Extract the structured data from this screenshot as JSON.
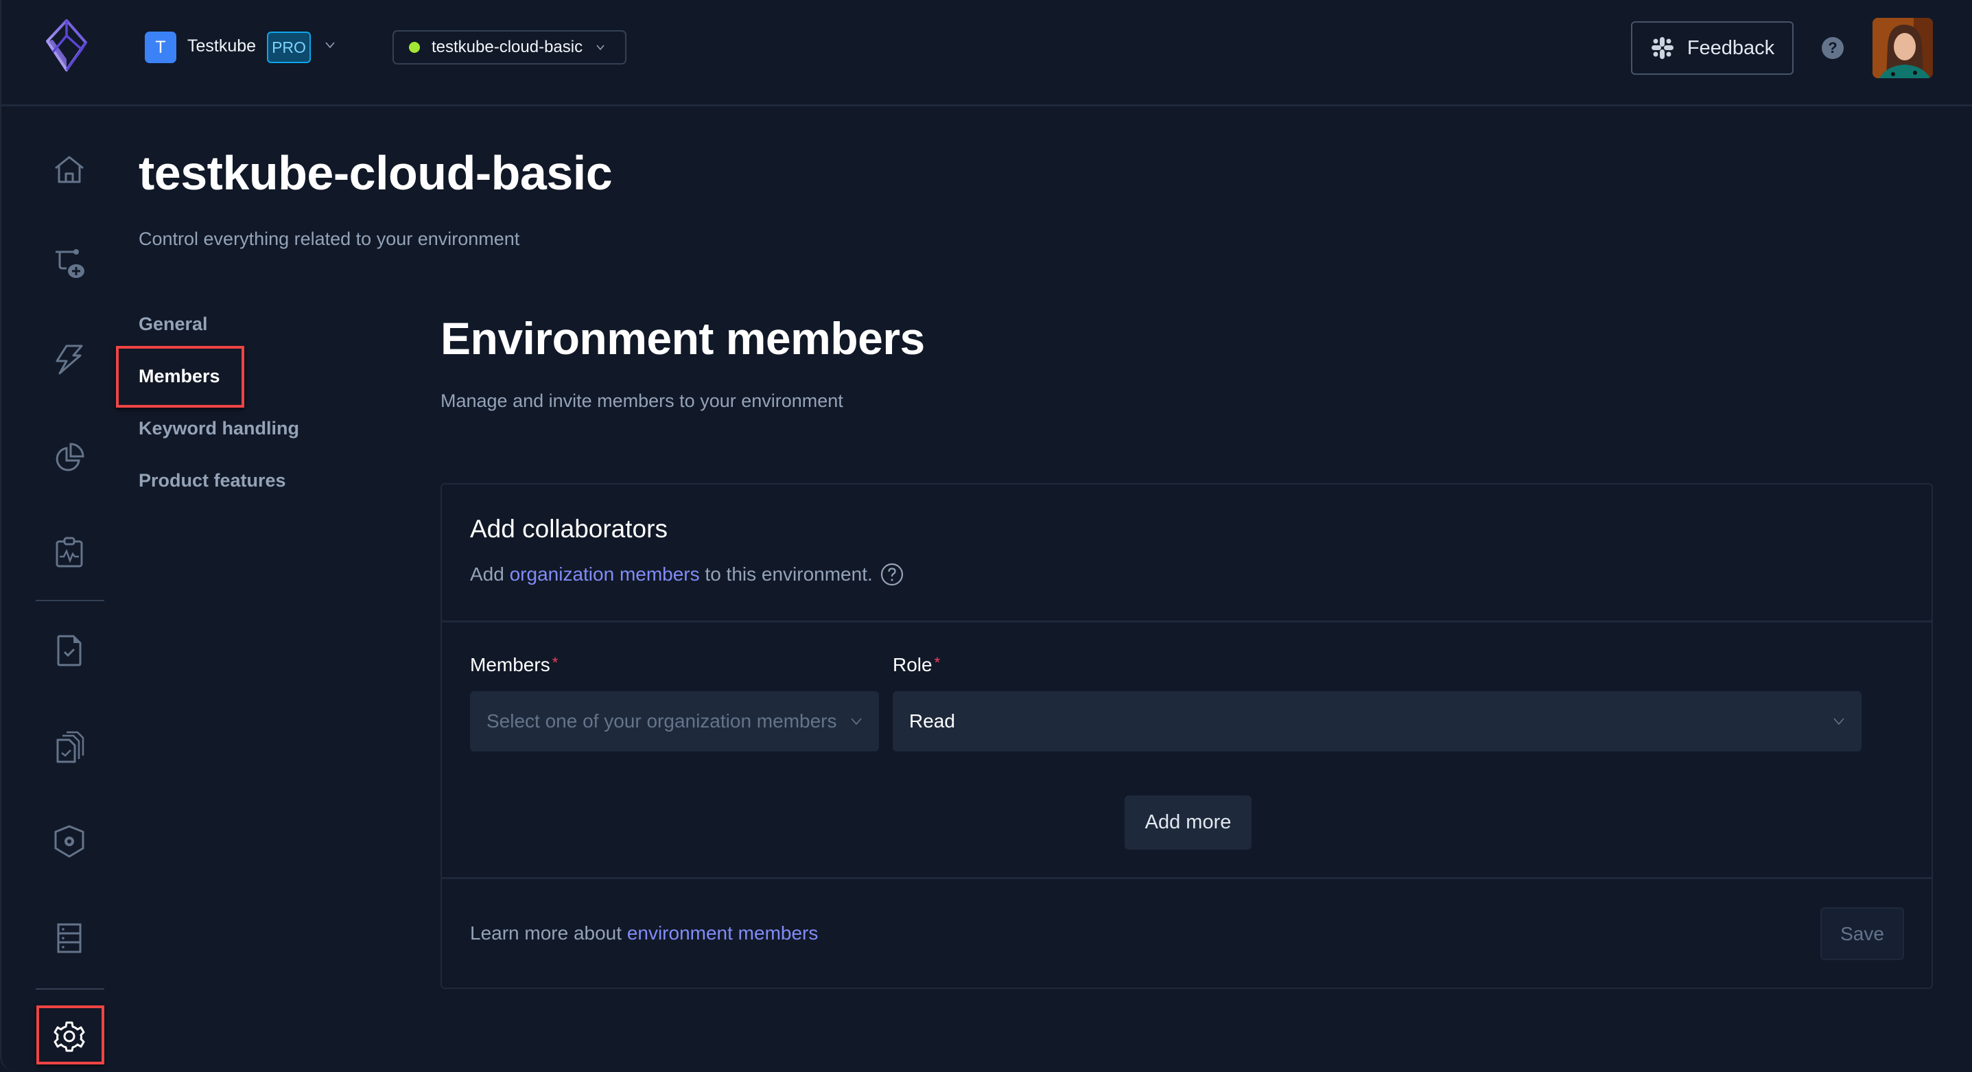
{
  "header": {
    "logo": "testkube-logo-icon",
    "workspace": {
      "initial": "T",
      "name": "Testkube",
      "plan_badge": "PRO"
    },
    "environment": {
      "name": "testkube-cloud-basic",
      "status_color": "#a3e635"
    },
    "feedback_label": "Feedback",
    "help_label": "?"
  },
  "sidebar": {
    "items": [
      {
        "name": "home",
        "icon": "home-icon"
      },
      {
        "name": "add-test-workflow",
        "icon": "workflow-add-icon"
      },
      {
        "name": "triggers",
        "icon": "lightning-icon"
      },
      {
        "name": "insights",
        "icon": "pie-chart-icon"
      },
      {
        "name": "status-pages",
        "icon": "clipboard-pulse-icon"
      },
      {
        "name": "tests",
        "icon": "file-check-icon"
      },
      {
        "name": "test-suites",
        "icon": "files-check-icon"
      },
      {
        "name": "executors",
        "icon": "shield-gear-icon"
      },
      {
        "name": "sources",
        "icon": "server-icon"
      },
      {
        "name": "settings",
        "icon": "gear-icon",
        "active": true
      }
    ]
  },
  "page": {
    "title": "testkube-cloud-basic",
    "subtitle": "Control everything related to your environment"
  },
  "settings_nav": {
    "items": [
      {
        "label": "General",
        "active": false
      },
      {
        "label": "Members",
        "active": true
      },
      {
        "label": "Keyword handling",
        "active": false
      },
      {
        "label": "Product features",
        "active": false
      }
    ]
  },
  "section": {
    "title": "Environment members",
    "subtitle": "Manage and invite members to your environment"
  },
  "card": {
    "title": "Add collaborators",
    "desc_prefix": "Add ",
    "desc_link": "organization members",
    "desc_suffix": " to this environment.",
    "members_label": "Members",
    "role_label": "Role",
    "required_mark": "*",
    "members_placeholder": "Select one of your organization members",
    "role_value": "Read",
    "add_more_label": "Add more",
    "footer_prefix": "Learn more about ",
    "footer_link": "environment members",
    "save_label": "Save"
  },
  "colors": {
    "background": "#111827",
    "accent_link": "#818cf8",
    "highlight": "#ef4444",
    "required": "#f43f5e",
    "workspace_avatar": "#3b82f6"
  }
}
